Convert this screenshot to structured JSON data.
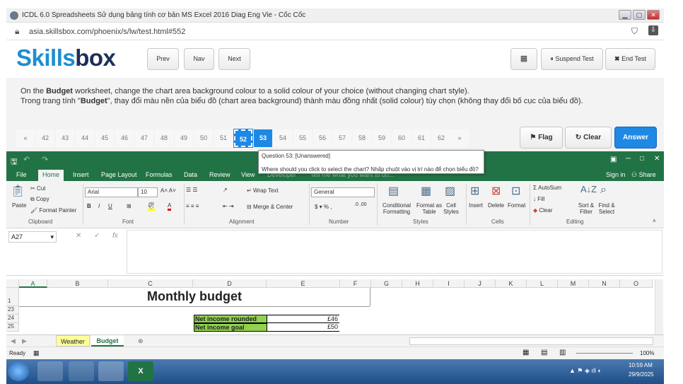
{
  "browser": {
    "title": "ICDL 6.0 Spreadsheets Sử dụng bảng tính cơ bản MS Excel 2016 Diag Eng Vie - Cốc Cốc",
    "url": "asia.skillsbox.com/phoenix/s/lw/test.html#552"
  },
  "header": {
    "logo_a": "Skills",
    "logo_b": "box",
    "prev": "Prev",
    "nav": "Nav",
    "next": "Next",
    "suspend": "Suspend Test",
    "end": "End Test"
  },
  "question": {
    "en_pre": "On the ",
    "en_bold": "Budget",
    "en_post": " worksheet, change the chart area background colour to a solid colour of your choice (without changing chart style).",
    "vi_pre": "Trong trang tính \"",
    "vi_bold": "Budget",
    "vi_post": "\", thay đổi màu nền của biểu đồ (chart area background) thành màu đồng nhất (solid colour) tùy chọn (không thay đổi bố cục của biểu đồ)."
  },
  "nav": {
    "first": "«",
    "last": "»",
    "numbers": [
      "42",
      "43",
      "44",
      "45",
      "46",
      "47",
      "48",
      "49",
      "50",
      "51",
      "52",
      "53",
      "54",
      "55",
      "56",
      "57",
      "58",
      "59",
      "60",
      "61",
      "62"
    ],
    "flag": "Flag",
    "clear": "Clear",
    "answer": "Answer"
  },
  "tooltip": {
    "line1": "Question 53: [Unanswered]",
    "line2": "Where should you click to select the chart? Nhấp chuột vào vị trí nào để chọn biểu đồ?"
  },
  "excel": {
    "tabs": [
      "File",
      "Home",
      "Insert",
      "Page Layout",
      "Formulas",
      "Data",
      "Review",
      "View",
      "Developer"
    ],
    "tell_me": "Tell me what you want to do...",
    "signin": "Sign in",
    "share": "Share",
    "clipboard": {
      "paste": "Paste",
      "cut": "Cut",
      "copy": "Copy",
      "format_painter": "Format Painter",
      "label": "Clipboard"
    },
    "font": {
      "name": "Arial",
      "size": "10",
      "label": "Font"
    },
    "alignment": {
      "wrap": "Wrap Text",
      "merge": "Merge & Center",
      "label": "Alignment"
    },
    "number": {
      "format": "General",
      "label": "Number"
    },
    "styles": {
      "cond": "Conditional Formatting",
      "table": "Format as Table",
      "cell": "Cell Styles",
      "label": "Styles"
    },
    "cells": {
      "insert": "Insert",
      "delete": "Delete",
      "format": "Format",
      "label": "Cells"
    },
    "editing": {
      "autosum": "AutoSum",
      "fill": "Fill",
      "clear": "Clear",
      "sort": "Sort & Filter",
      "find": "Find & Select",
      "label": "Editing"
    },
    "namebox": "A27",
    "columns": [
      "A",
      "B",
      "C",
      "D",
      "E",
      "F",
      "G",
      "H",
      "I",
      "J",
      "K",
      "L",
      "M",
      "N",
      "O"
    ],
    "rows": [
      "1",
      "23",
      "24",
      "25"
    ],
    "title_cell": "Monthly budget",
    "rows_data": [
      {
        "label": "Net income rounded",
        "value": "£46"
      },
      {
        "label": "Net income goal",
        "value": "£50"
      }
    ],
    "sheets": [
      "Weather",
      "Budget"
    ],
    "status": "Ready",
    "zoom": "100%"
  },
  "taskbar": {
    "time": "10:59 AM",
    "date": "29/9/2025"
  },
  "colors": {
    "accent": "#1e88e5",
    "excel_green": "#217346",
    "sheet_tab": "#ffff99"
  }
}
